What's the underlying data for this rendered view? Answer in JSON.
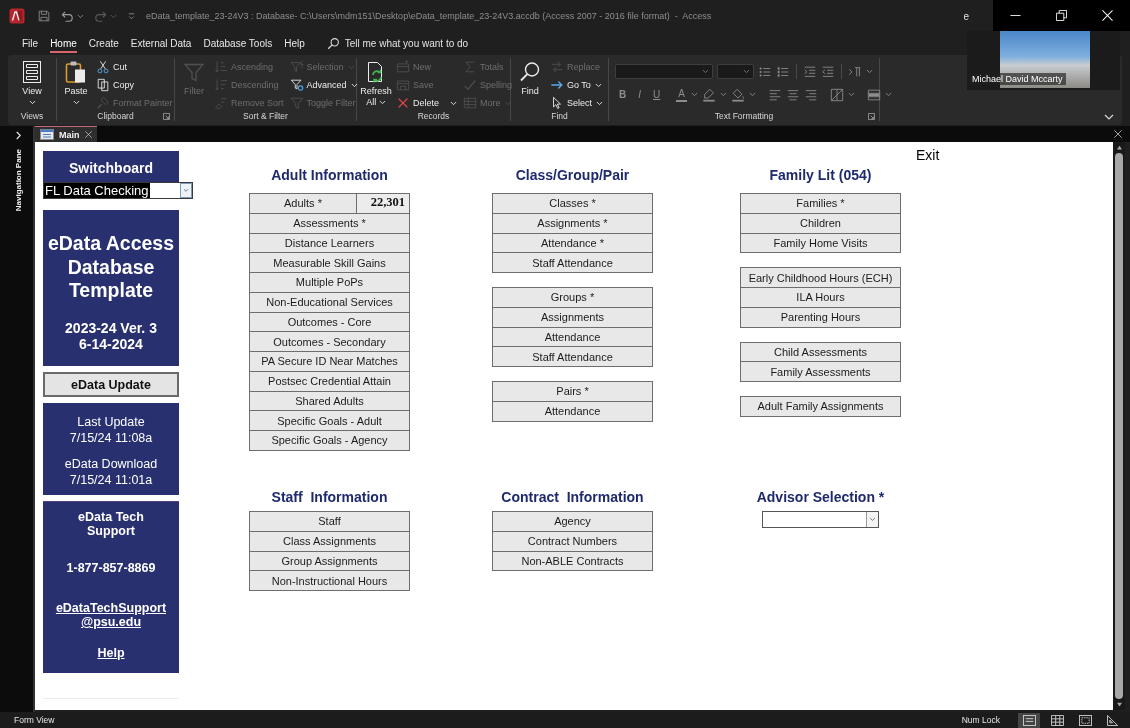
{
  "title_bar": {
    "title": "eData_template_23-24V3 : Database- C:\\Users\\mdm151\\Desktop\\eData_template_23-24V3.accdb (Access 2007 - 2016 file format)  -  Access",
    "account": "e"
  },
  "video_overlay": {
    "name": "Michael David Mccarty"
  },
  "menu_tabs": [
    {
      "label": "File",
      "selected": false
    },
    {
      "label": "Home",
      "selected": true
    },
    {
      "label": "Create",
      "selected": false
    },
    {
      "label": "External Data",
      "selected": false
    },
    {
      "label": "Database Tools",
      "selected": false
    },
    {
      "label": "Help",
      "selected": false
    }
  ],
  "tell_me": {
    "placeholder": "Tell me what you want to do"
  },
  "ribbon_groups": [
    {
      "label": "Views",
      "launcher": false,
      "commands": [
        {
          "kind": "large",
          "label": "View",
          "disabled": false,
          "dropdown": true
        }
      ]
    },
    {
      "label": "Clipboard",
      "launcher": true,
      "commands": [
        {
          "kind": "large",
          "label": "Paste",
          "disabled": false,
          "dropdown": true
        },
        {
          "kind": "small",
          "label": "Cut",
          "disabled": false,
          "dropdown": false
        },
        {
          "kind": "small",
          "label": "Copy",
          "disabled": false,
          "dropdown": false
        },
        {
          "kind": "small",
          "label": "Format Painter",
          "disabled": true,
          "dropdown": false
        }
      ]
    },
    {
      "label": "Sort & Filter",
      "launcher": false,
      "commands": [
        {
          "kind": "large",
          "label": "Filter",
          "disabled": true,
          "dropdown": false
        },
        {
          "kind": "small",
          "label": "Ascending",
          "disabled": true,
          "dropdown": false
        },
        {
          "kind": "small",
          "label": "Descending",
          "disabled": true,
          "dropdown": false
        },
        {
          "kind": "small",
          "label": "Remove Sort",
          "disabled": true,
          "dropdown": false
        },
        {
          "kind": "small",
          "label": "Selection",
          "disabled": true,
          "dropdown": true
        },
        {
          "kind": "small",
          "label": "Advanced",
          "disabled": false,
          "dropdown": true
        },
        {
          "kind": "small",
          "label": "Toggle Filter",
          "disabled": true,
          "dropdown": false
        }
      ]
    },
    {
      "label": "Records",
      "launcher": false,
      "commands": [
        {
          "kind": "large",
          "label": "Refresh All",
          "disabled": false,
          "dropdown": true
        },
        {
          "kind": "small",
          "label": "New",
          "disabled": true,
          "dropdown": false
        },
        {
          "kind": "small",
          "label": "Save",
          "disabled": true,
          "dropdown": false
        },
        {
          "kind": "small",
          "label": "Delete",
          "disabled": false,
          "dropdown": true
        },
        {
          "kind": "small",
          "label": "Totals",
          "disabled": true,
          "dropdown": false
        },
        {
          "kind": "small",
          "label": "Spelling",
          "disabled": true,
          "dropdown": false
        },
        {
          "kind": "small",
          "label": "More",
          "disabled": true,
          "dropdown": true
        }
      ]
    },
    {
      "label": "Find",
      "launcher": false,
      "commands": [
        {
          "kind": "large",
          "label": "Find",
          "disabled": false,
          "dropdown": false
        },
        {
          "kind": "small",
          "label": "Replace",
          "disabled": true,
          "dropdown": false
        },
        {
          "kind": "small",
          "label": "Go To",
          "disabled": false,
          "dropdown": true
        },
        {
          "kind": "small",
          "label": "Select",
          "disabled": false,
          "dropdown": true
        }
      ]
    }
  ],
  "text_formatting": {
    "label": "Text Formatting",
    "launcher": true,
    "disabled": true,
    "style_buttons": [
      "B",
      "I",
      "U"
    ],
    "font_color": "A"
  },
  "navigation_pane": {
    "label": "Navigation Pane"
  },
  "document_tabs": [
    {
      "label": "Main",
      "selected": true
    }
  ],
  "switchboard": {
    "title": "Switchboard",
    "selection": "FL Data Checking"
  },
  "banner": {
    "title": "eData Access Database Template",
    "version": "2023-24 Ver. 3",
    "date": "6-14-2024"
  },
  "update_button": "eData Update",
  "updates": [
    {
      "label": "Last Update",
      "value": "7/15/24 11:08a"
    },
    {
      "label": "eData Download",
      "value": "7/15/24 11:01a"
    }
  ],
  "support": {
    "title": "eData Tech Support",
    "phone": "1-877-857-8869",
    "email": "eDataTechSupport @psu.edu",
    "help": "Help"
  },
  "exit": "Exit",
  "sections": [
    {
      "title": "Adult Information",
      "kind": "buttons",
      "count": "22,301",
      "groups": [
        [
          "Adults *",
          "Assessments *",
          "Distance Learners",
          "Measurable Skill Gains",
          "Multiple PoPs",
          "Non-Educational Services",
          "Outcomes - Core",
          "Outcomes - Secondary",
          "PA Secure ID Near Matches",
          "Postsec Credential Attain",
          "Shared Adults",
          "Specific Goals - Adult",
          "Specific Goals - Agency"
        ]
      ]
    },
    {
      "title": "Class/Group/Pair",
      "kind": "buttons",
      "groups": [
        [
          "Classes *",
          "Assignments *",
          "Attendance *",
          "Staff Attendance"
        ],
        [
          "Groups *",
          "Assignments",
          "Attendance",
          "Staff Attendance"
        ],
        [
          "Pairs *",
          "Attendance"
        ]
      ]
    },
    {
      "title": "Family Lit (054)",
      "kind": "buttons",
      "groups": [
        [
          "Families *",
          "Children",
          "Family Home Visits"
        ],
        [
          "Early Childhood Hours (ECH)",
          "ILA Hours",
          "Parenting Hours"
        ],
        [
          "Child Assessments",
          "Family Assessments"
        ],
        [
          "Adult Family Assignments"
        ]
      ]
    },
    {
      "title": "Staff  Information",
      "kind": "buttons",
      "groups": [
        [
          "Staff",
          "Class Assignments",
          "Group Assignments",
          "Non-Instructional Hours"
        ]
      ]
    },
    {
      "title": "Contract  Information",
      "kind": "buttons",
      "groups": [
        [
          "Agency",
          "Contract Numbers",
          "Non-ABLE Contracts"
        ]
      ]
    },
    {
      "title": "Advisor Selection *",
      "kind": "combo"
    }
  ],
  "status_bar": {
    "mode": "Form View",
    "indicator": "Num Lock",
    "views": [
      {
        "selected": true
      },
      {
        "selected": false
      },
      {
        "selected": false
      },
      {
        "selected": false
      }
    ]
  }
}
